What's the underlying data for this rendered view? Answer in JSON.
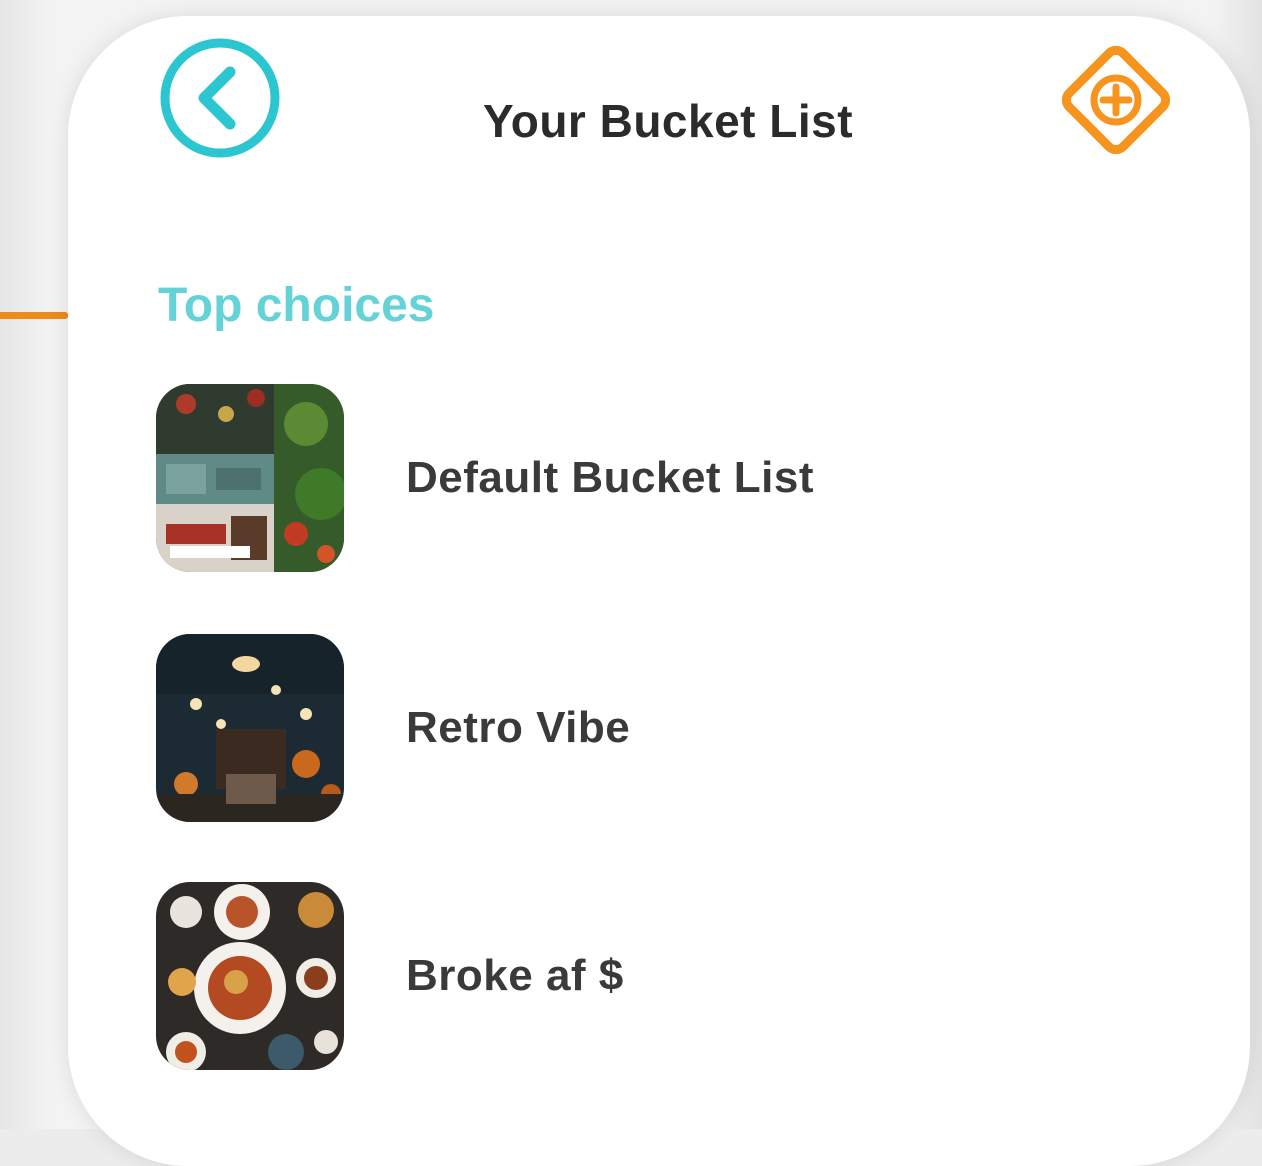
{
  "header": {
    "title": "Your Bucket List",
    "back_icon": "chevron-left-circle-icon",
    "add_icon": "diamond-plus-icon"
  },
  "colors": {
    "accent_teal": "#2cc6d0",
    "accent_orange": "#f7941d",
    "section_label": "#63d3d8",
    "text_dark": "#2b2b2b"
  },
  "section": {
    "label": "Top choices"
  },
  "lists": [
    {
      "name": "Default Bucket List"
    },
    {
      "name": "Retro Vibe"
    },
    {
      "name": "Broke af $"
    }
  ]
}
